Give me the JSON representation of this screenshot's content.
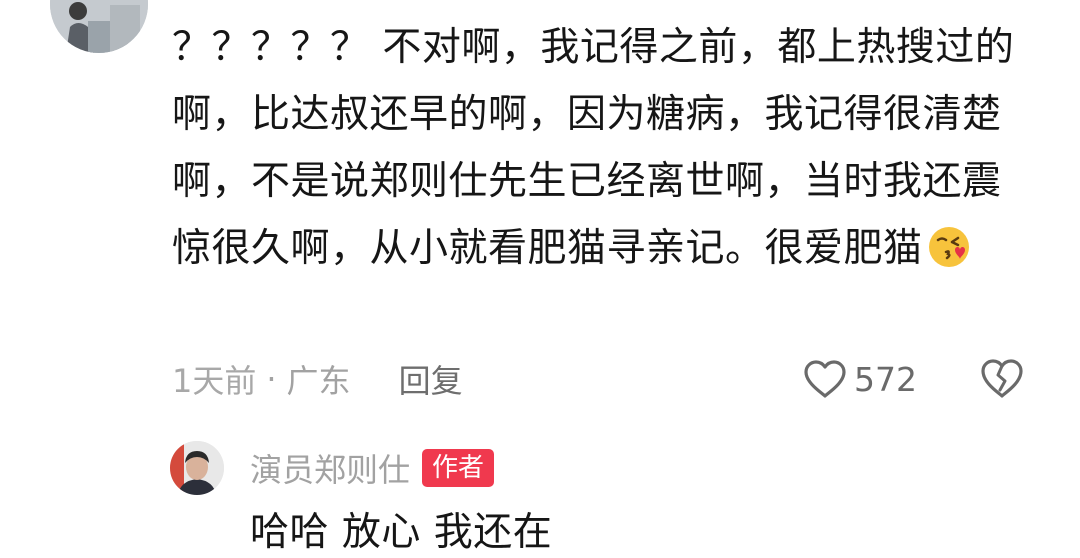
{
  "comment": {
    "text": "？？？？？ 不对啊，我记得之前，都上热搜过的啊，比达叔还早的啊，因为糖病，我记得很清楚啊，不是说郑则仕先生已经离世啊，当时我还震惊很久啊，从小就看肥猫寻亲记。很爱肥猫",
    "emoji_icon": "kissing-heart-emoji-icon",
    "time": "1天前",
    "separator": "·",
    "location": "广东",
    "reply_label": "回复",
    "like_count": "572"
  },
  "reply": {
    "author": "演员郑则仕",
    "badge": "作者",
    "text": "哈哈 放心 我还在"
  },
  "colors": {
    "badge": "#f0394e",
    "text": "#161616",
    "meta": "#a2a2a2"
  }
}
